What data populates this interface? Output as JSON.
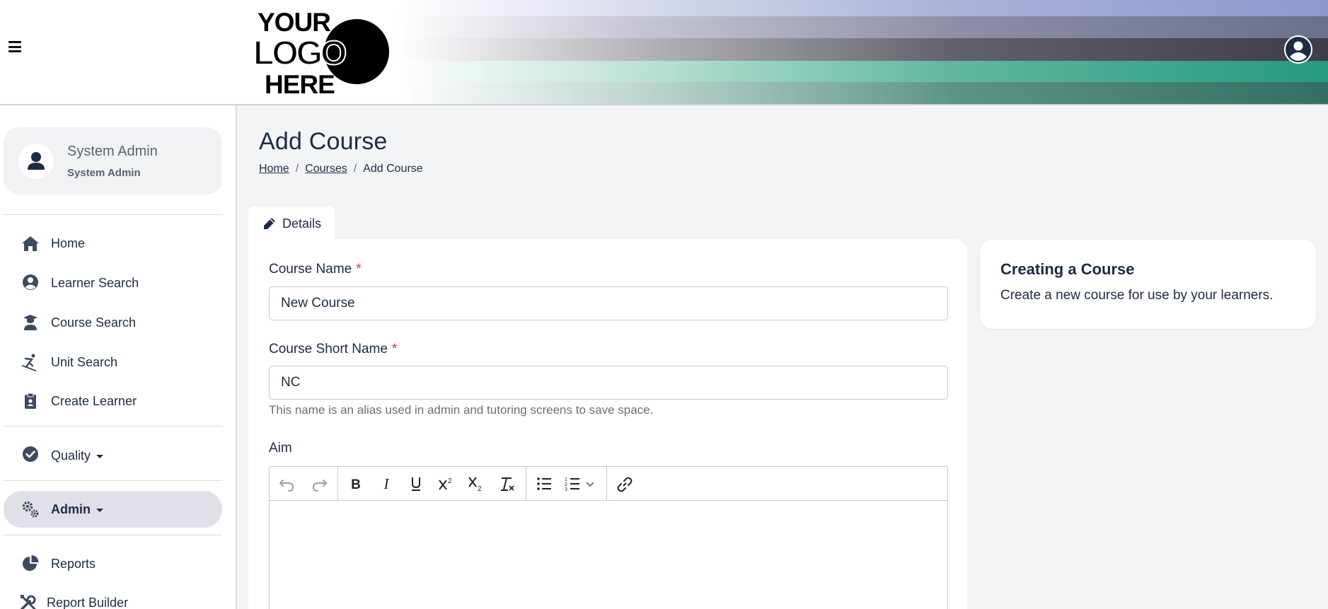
{
  "header": {
    "menu_icon": "hamburger-icon",
    "logo_lines": [
      "YOUR",
      "LOGO",
      "HERE"
    ],
    "account_icon": "user-circle-icon"
  },
  "sidebar": {
    "profile": {
      "name": "System Admin",
      "role": "System Admin",
      "icon": "user-icon"
    },
    "items": [
      {
        "label": "Home",
        "icon": "home-icon"
      },
      {
        "label": "Learner Search",
        "icon": "user-circle-icon"
      },
      {
        "label": "Course Search",
        "icon": "graduate-icon"
      },
      {
        "label": "Unit Search",
        "icon": "skiing-icon"
      },
      {
        "label": "Create Learner",
        "icon": "clipboard-user-icon"
      },
      {
        "label": "Quality",
        "icon": "check-circle-icon"
      },
      {
        "label": "Admin",
        "icon": "cogs-icon"
      },
      {
        "label": "Reports",
        "icon": "pie-chart-icon"
      },
      {
        "label": "Report Builder",
        "icon": "tools-icon"
      }
    ]
  },
  "page": {
    "title": "Add Course",
    "breadcrumb": [
      "Home",
      "Courses",
      "Add Course"
    ],
    "separator": "/"
  },
  "tabs": [
    {
      "label": "Details",
      "icon": "pencil-icon"
    }
  ],
  "form": {
    "course_name": {
      "label": "Course Name",
      "required_mark": "*",
      "value": "New Course"
    },
    "course_short_name": {
      "label": "Course Short Name",
      "required_mark": "*",
      "value": "NC",
      "help": "This name is an alias used in admin and tutoring screens to save space."
    },
    "aim": {
      "label": "Aim"
    },
    "toolbar": [
      "undo-icon",
      "redo-icon",
      "bold-icon",
      "italic-icon",
      "underline-icon",
      "superscript-icon",
      "subscript-icon",
      "clear-format-icon",
      "bullet-list-icon",
      "numbered-list-icon",
      "chevron-down-icon",
      "link-icon"
    ]
  },
  "info": {
    "title": "Creating a Course",
    "text": "Create a new course for use by your learners."
  },
  "colors": {
    "primary_text": "#1d2b45",
    "required": "#e0332f",
    "active_nav_bg": "#e1e0e9"
  }
}
